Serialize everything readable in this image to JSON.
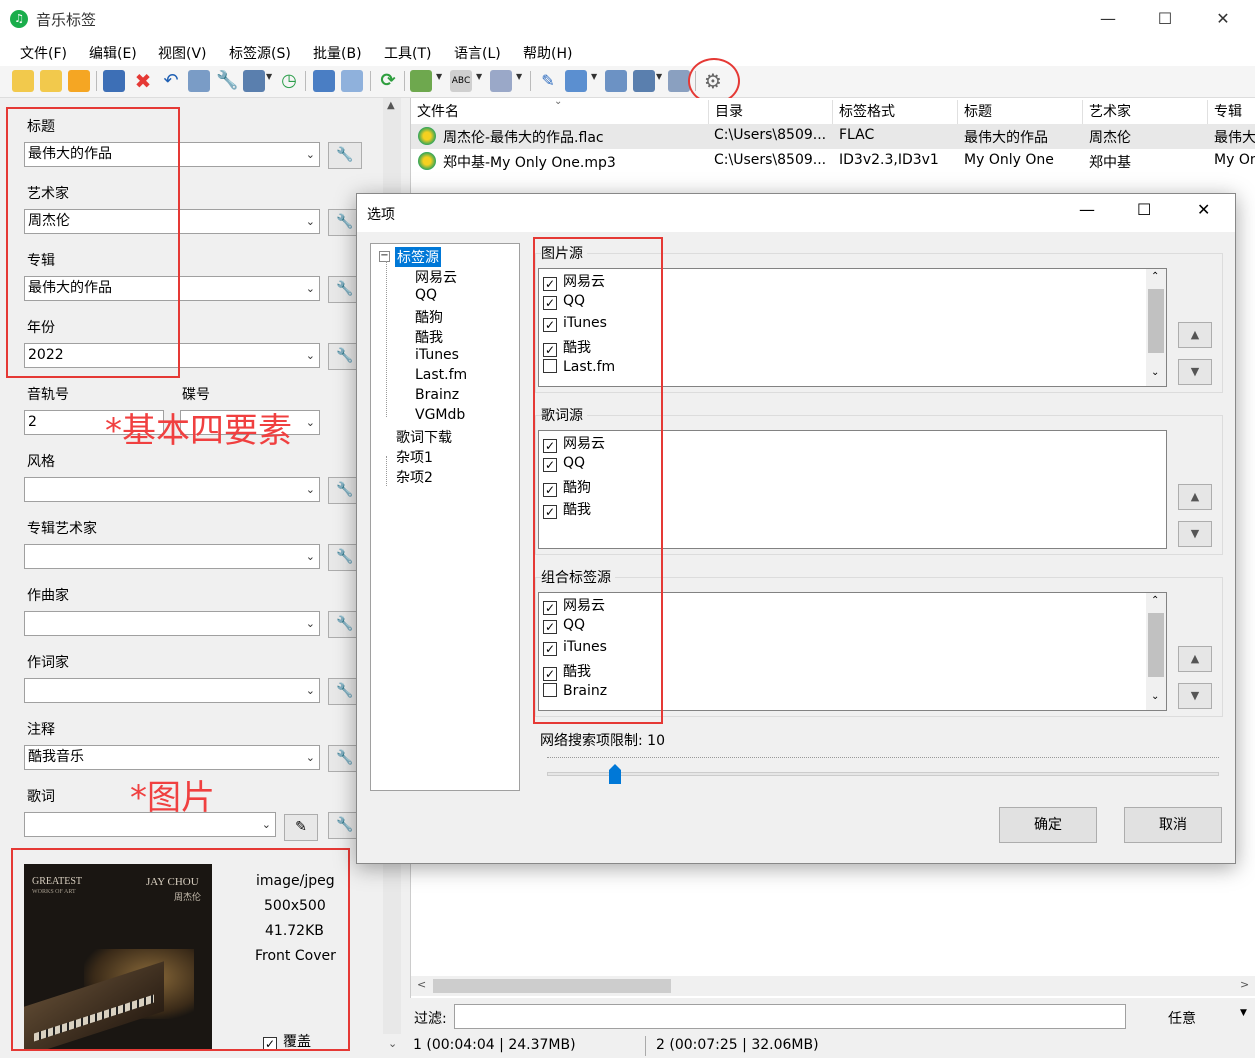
{
  "app": {
    "title": "音乐标签",
    "icon": "music-note-icon",
    "min": "—",
    "max": "☐",
    "close": "✕"
  },
  "menu": [
    "文件(F)",
    "编辑(E)",
    "视图(V)",
    "标签源(S)",
    "批量(B)",
    "工具(T)",
    "语言(L)",
    "帮助(H)"
  ],
  "fields": {
    "title": {
      "label": "标题",
      "value": "最伟大的作品"
    },
    "artist": {
      "label": "艺术家",
      "value": "周杰伦"
    },
    "album": {
      "label": "专辑",
      "value": "最伟大的作品"
    },
    "year": {
      "label": "年份",
      "value": "2022"
    },
    "track": {
      "label": "音轨号",
      "value": "2"
    },
    "disc": {
      "label": "碟号",
      "value": ""
    },
    "genre": {
      "label": "风格",
      "value": ""
    },
    "album_artist": {
      "label": "专辑艺术家",
      "value": ""
    },
    "composer": {
      "label": "作曲家",
      "value": ""
    },
    "lyricist": {
      "label": "作词家",
      "value": ""
    },
    "comment": {
      "label": "注释",
      "value": "酷我音乐"
    },
    "lyrics": {
      "label": "歌词",
      "value": ""
    }
  },
  "annotations": {
    "basic": "*基本四要素",
    "picture": "*图片"
  },
  "cover": {
    "mime": "image/jpeg",
    "size": "500x500",
    "filesize": "41.72KB",
    "type": "Front Cover",
    "overwrite_label": "覆盖",
    "overwrite_checked": true,
    "art_left": "GREATEST",
    "art_left_sub": "WORKS OF ART",
    "art_right": "JAY CHOU",
    "art_right_sub": "周杰伦"
  },
  "filelist": {
    "columns": [
      "文件名",
      "目录",
      "标签格式",
      "标题",
      "艺术家",
      "专辑"
    ],
    "rows": [
      {
        "name": "周杰伦-最伟大的作品.flac",
        "dir": "C:\\Users\\8509...",
        "format": "FLAC",
        "title": "最伟大的作品",
        "artist": "周杰伦",
        "album": "最伟大"
      },
      {
        "name": "郑中基-My Only One.mp3",
        "dir": "C:\\Users\\8509...",
        "format": "ID3v2.3,ID3v1",
        "title": "My Only One",
        "artist": "郑中基",
        "album": "My On"
      }
    ]
  },
  "filter": {
    "label": "过滤:",
    "value": "",
    "mode": "任意"
  },
  "status": {
    "left": "1 (00:04:04 | 24.37MB)",
    "right": "2 (00:07:25 | 32.06MB)"
  },
  "dialog": {
    "title": "选项",
    "tree": {
      "root": "标签源",
      "children": [
        "网易云",
        "QQ",
        "酷狗",
        "酷我",
        "iTunes",
        "Last.fm",
        "Brainz",
        "VGMdb"
      ],
      "others": [
        "歌词下载",
        "杂项1",
        "杂项2"
      ]
    },
    "image_sources": {
      "title": "图片源",
      "items": [
        {
          "label": "网易云",
          "checked": true
        },
        {
          "label": "QQ",
          "checked": true
        },
        {
          "label": "iTunes",
          "checked": true
        },
        {
          "label": "酷我",
          "checked": true
        },
        {
          "label": "Last.fm",
          "checked": false
        }
      ]
    },
    "lyric_sources": {
      "title": "歌词源",
      "items": [
        {
          "label": "网易云",
          "checked": true
        },
        {
          "label": "QQ",
          "checked": true
        },
        {
          "label": "酷狗",
          "checked": true
        },
        {
          "label": "酷我",
          "checked": true
        }
      ]
    },
    "combined_sources": {
      "title": "组合标签源",
      "items": [
        {
          "label": "网易云",
          "checked": true
        },
        {
          "label": "QQ",
          "checked": true
        },
        {
          "label": "iTunes",
          "checked": true
        },
        {
          "label": "酷我",
          "checked": true
        },
        {
          "label": "Brainz",
          "checked": false
        }
      ]
    },
    "search_limit_label": "网络搜索项限制: 10",
    "search_limit": 10,
    "ok": "确定",
    "cancel": "取消"
  },
  "colors": {
    "accent": "#0078d7",
    "annotation": "#e53935"
  }
}
